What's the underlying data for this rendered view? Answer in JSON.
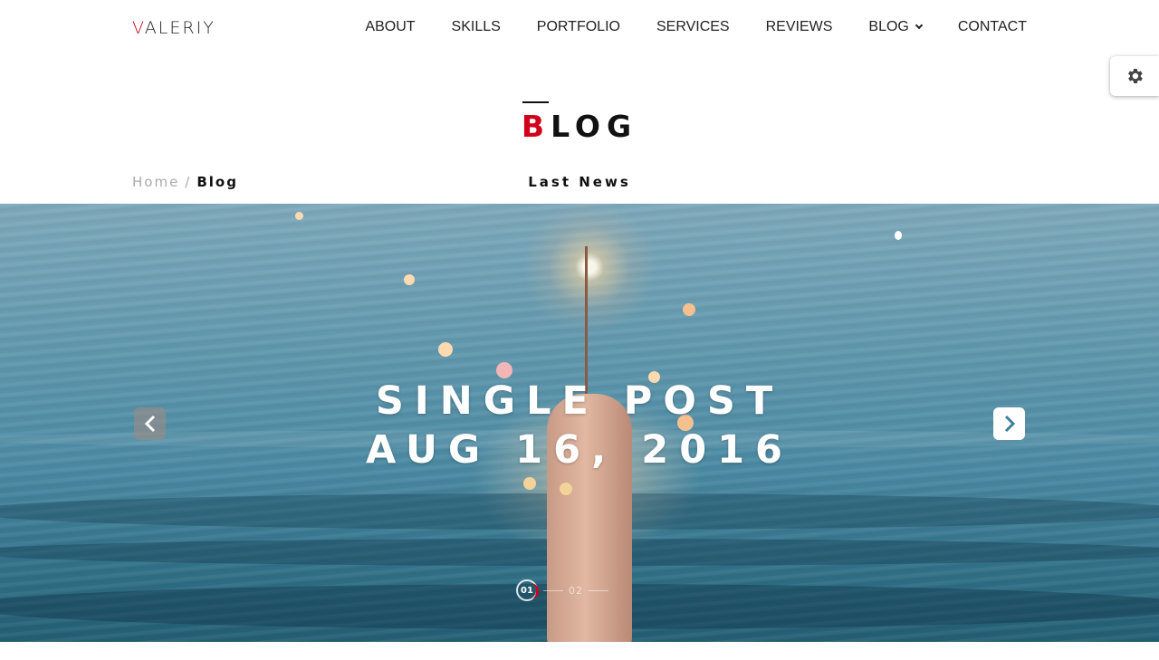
{
  "brand": {
    "logo_first": "V",
    "logo_rest": "ALERIY",
    "accent_color": "#d0021b"
  },
  "nav": {
    "items": [
      {
        "label": "ABOUT"
      },
      {
        "label": "SKILLS"
      },
      {
        "label": "PORTFOLIO"
      },
      {
        "label": "SERVICES"
      },
      {
        "label": "REVIEWS"
      },
      {
        "label": "BLOG",
        "has_dropdown": true
      },
      {
        "label": "CONTACT"
      }
    ]
  },
  "settings": {
    "icon": "gear-icon"
  },
  "page": {
    "title_first": "B",
    "title_rest": "LOG",
    "subtitle": "Last News"
  },
  "breadcrumb": {
    "home": "Home",
    "separator": "/",
    "current": "Blog"
  },
  "hero": {
    "line1": "SINGLE POST",
    "line2": "AUG 16, 2016",
    "prev_icon": "chevron-left-icon",
    "next_icon": "chevron-right-icon",
    "pager": {
      "active": "01",
      "next": "02"
    }
  }
}
